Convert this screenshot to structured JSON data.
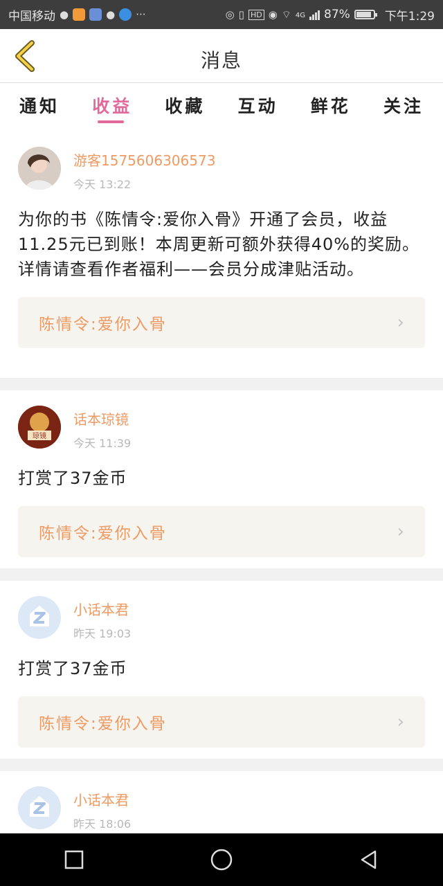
{
  "status_bar": {
    "carrier": "中国移动",
    "network": "4G",
    "battery": "87%",
    "battery_level": 0.87,
    "time": "下午1:29"
  },
  "header": {
    "title": "消息",
    "back_icon": "chevron-left-icon"
  },
  "tabs": [
    {
      "label": "通知"
    },
    {
      "label": "收益",
      "active": true
    },
    {
      "label": "收藏"
    },
    {
      "label": "互动"
    },
    {
      "label": "鲜花"
    },
    {
      "label": "关注"
    }
  ],
  "messages": [
    {
      "name": "游客1575606306573",
      "time": "今天 13:22",
      "content": "为你的书《陈情令:爱你入骨》开通了会员，收益11.25元已到账！本周更新可额外获得40%的奖励。详情请查看作者福利——会员分成津贴活动。",
      "book": "陈情令:爱你入骨",
      "avatar": "user-photo"
    },
    {
      "name": "话本琼镜",
      "time": "今天 11:39",
      "content": "打赏了37金币",
      "book": "陈情令:爱你入骨",
      "avatar": "琼镜",
      "avatar_text": "琼镜"
    },
    {
      "name": "小话本君",
      "time": "昨天 19:03",
      "content": "打赏了37金币",
      "book": "陈情令:爱你入骨",
      "avatar": "default-avatar"
    },
    {
      "name": "小话本君",
      "time": "昨天 18:06",
      "avatar": "default-avatar"
    }
  ],
  "colors": {
    "accent": "#e16a9c",
    "name": "#ef9a62",
    "book_bg": "#f6f4ef"
  }
}
